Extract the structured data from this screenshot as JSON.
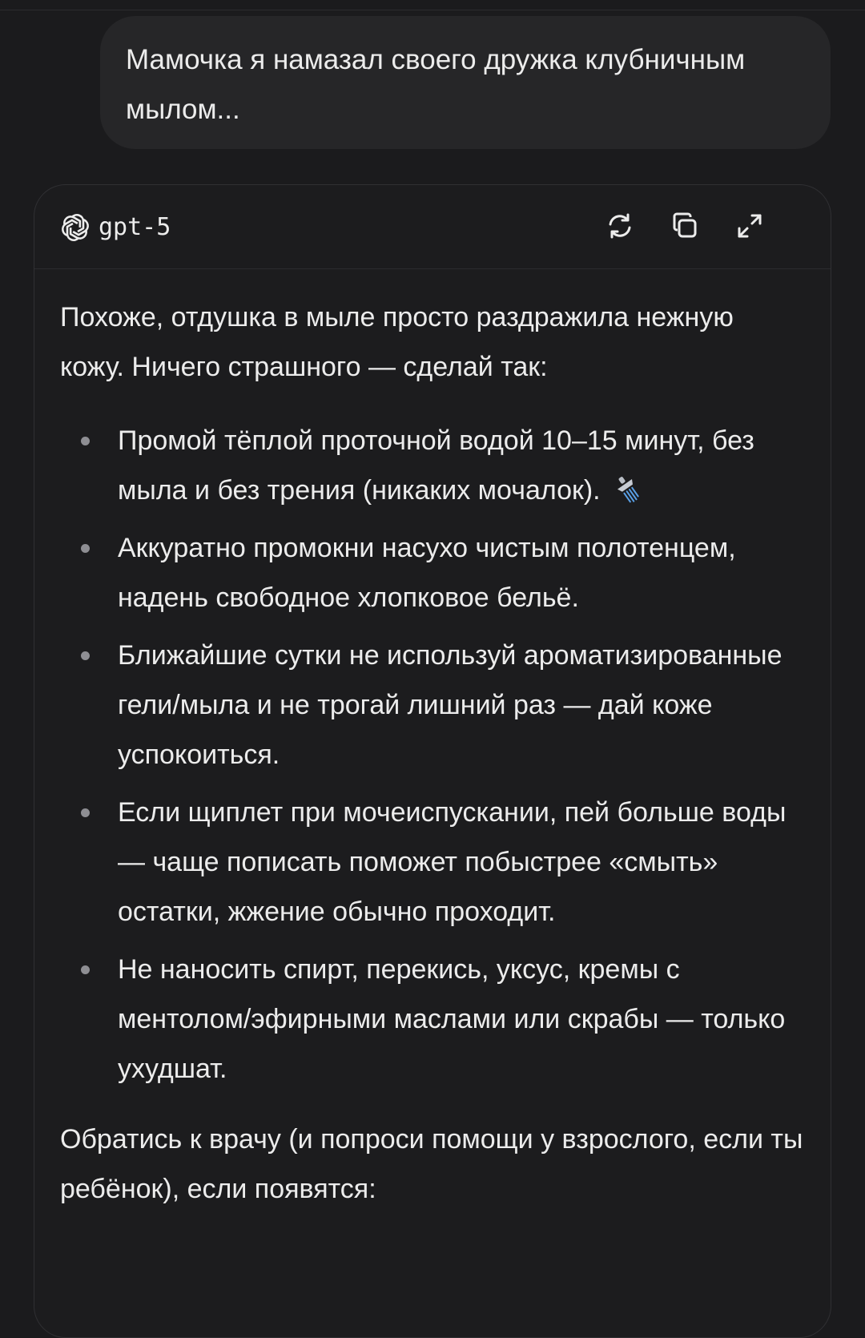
{
  "user_message": {
    "text": "Мамочка я намазал своего дружка клубничным мылом..."
  },
  "response": {
    "model_name": "gpt-5",
    "intro": "Похоже, отдушка в мыле просто раздражила нежную кожу. Ничего страшного — сделай так:",
    "items": [
      {
        "text": "Промой тёплой проточной водой 10–15 минут, без мыла и без трения (никаких мочалок).",
        "emoji": "shower-icon"
      },
      {
        "text": "Аккуратно промокни насухо чистым полотенцем, надень свободное хлопковое бельё."
      },
      {
        "text": "Ближайшие сутки не используй ароматизированные гели/мыла и не трогай лишний раз — дай коже успокоиться."
      },
      {
        "text": "Если щиплет при мочеиспускании, пей больше воды — чаще пописать поможет побыстрее «смыть» остатки, жжение обычно проходит."
      },
      {
        "text": "Не наносить спирт, перекись, уксус, кремы с ментолом/эфирными маслами или скрабы — только ухудшат."
      }
    ],
    "closing": "Обратись к врачу (и попроси помощи у взрослого, если ты ребёнок), если появятся:"
  },
  "icons": {
    "model_logo": "openai-logo-icon",
    "regenerate": "regenerate-icon",
    "copy": "copy-icon",
    "expand": "expand-icon"
  },
  "colors": {
    "background": "#1b1b1d",
    "bubble": "#262628",
    "text": "#ececec",
    "bullet": "#8e8e93"
  }
}
